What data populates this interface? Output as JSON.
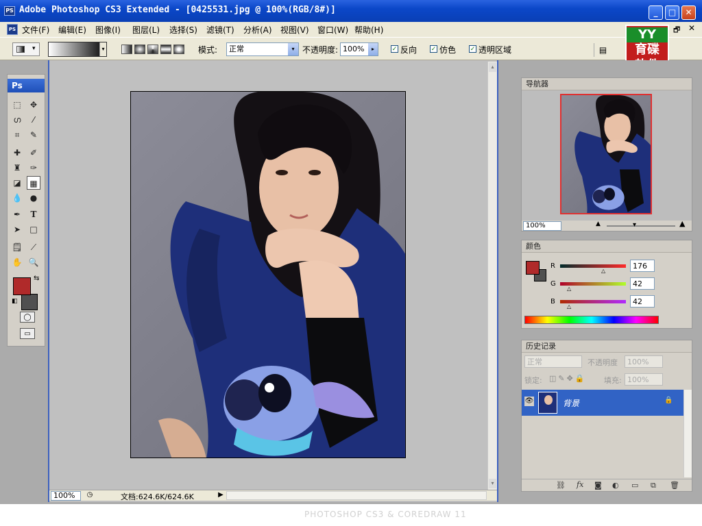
{
  "window": {
    "title": "Adobe Photoshop CS3 Extended - [0425531.jpg @ 100%(RGB/8#)]",
    "app_icon": "PS",
    "minimize": "_",
    "maximize": "□",
    "close": "✕",
    "restore": "🗗",
    "doc_close": "✕"
  },
  "menu": [
    "文件(F)",
    "编辑(E)",
    "图像(I)",
    "图层(L)",
    "选择(S)",
    "滤镜(T)",
    "分析(A)",
    "视图(V)",
    "窗口(W)",
    "帮助(H)"
  ],
  "options": {
    "mode_label": "模式:",
    "mode_value": "正常",
    "opacity_label": "不透明度:",
    "opacity_value": "100%",
    "reverse_label": "反向",
    "dither_label": "仿色",
    "transparency_label": "透明区域"
  },
  "watermark": {
    "line1": "育碟",
    "line2": "软件",
    "logo": "YY"
  },
  "toolbox": {
    "logo": "Ps"
  },
  "status": {
    "zoom": "100%",
    "doc_info": "文档:624.6K/624.6K"
  },
  "navigator": {
    "title": "导航器",
    "zoom": "100%"
  },
  "color": {
    "title": "颜色",
    "r_label": "R",
    "r_value": "176",
    "g_label": "G",
    "g_value": "42",
    "b_label": "B",
    "b_value": "42",
    "foreground": "#b02a2a",
    "background": "#505050"
  },
  "history": {
    "title": "历史记录",
    "blend": "正常",
    "opacity_label": "不透明度",
    "opacity_value": "100%",
    "lock_label": "锁定:",
    "fill_label": "填充:",
    "fill_value": "100%",
    "layer_name": "背景"
  },
  "bottom_caption": "PHOTOSHOP CS3 & COREDRAW 11",
  "colors": {
    "accent": "#3163c5",
    "titlebar": "#0b47c8",
    "chrome": "#ece9d8",
    "workspace": "#ababab"
  }
}
